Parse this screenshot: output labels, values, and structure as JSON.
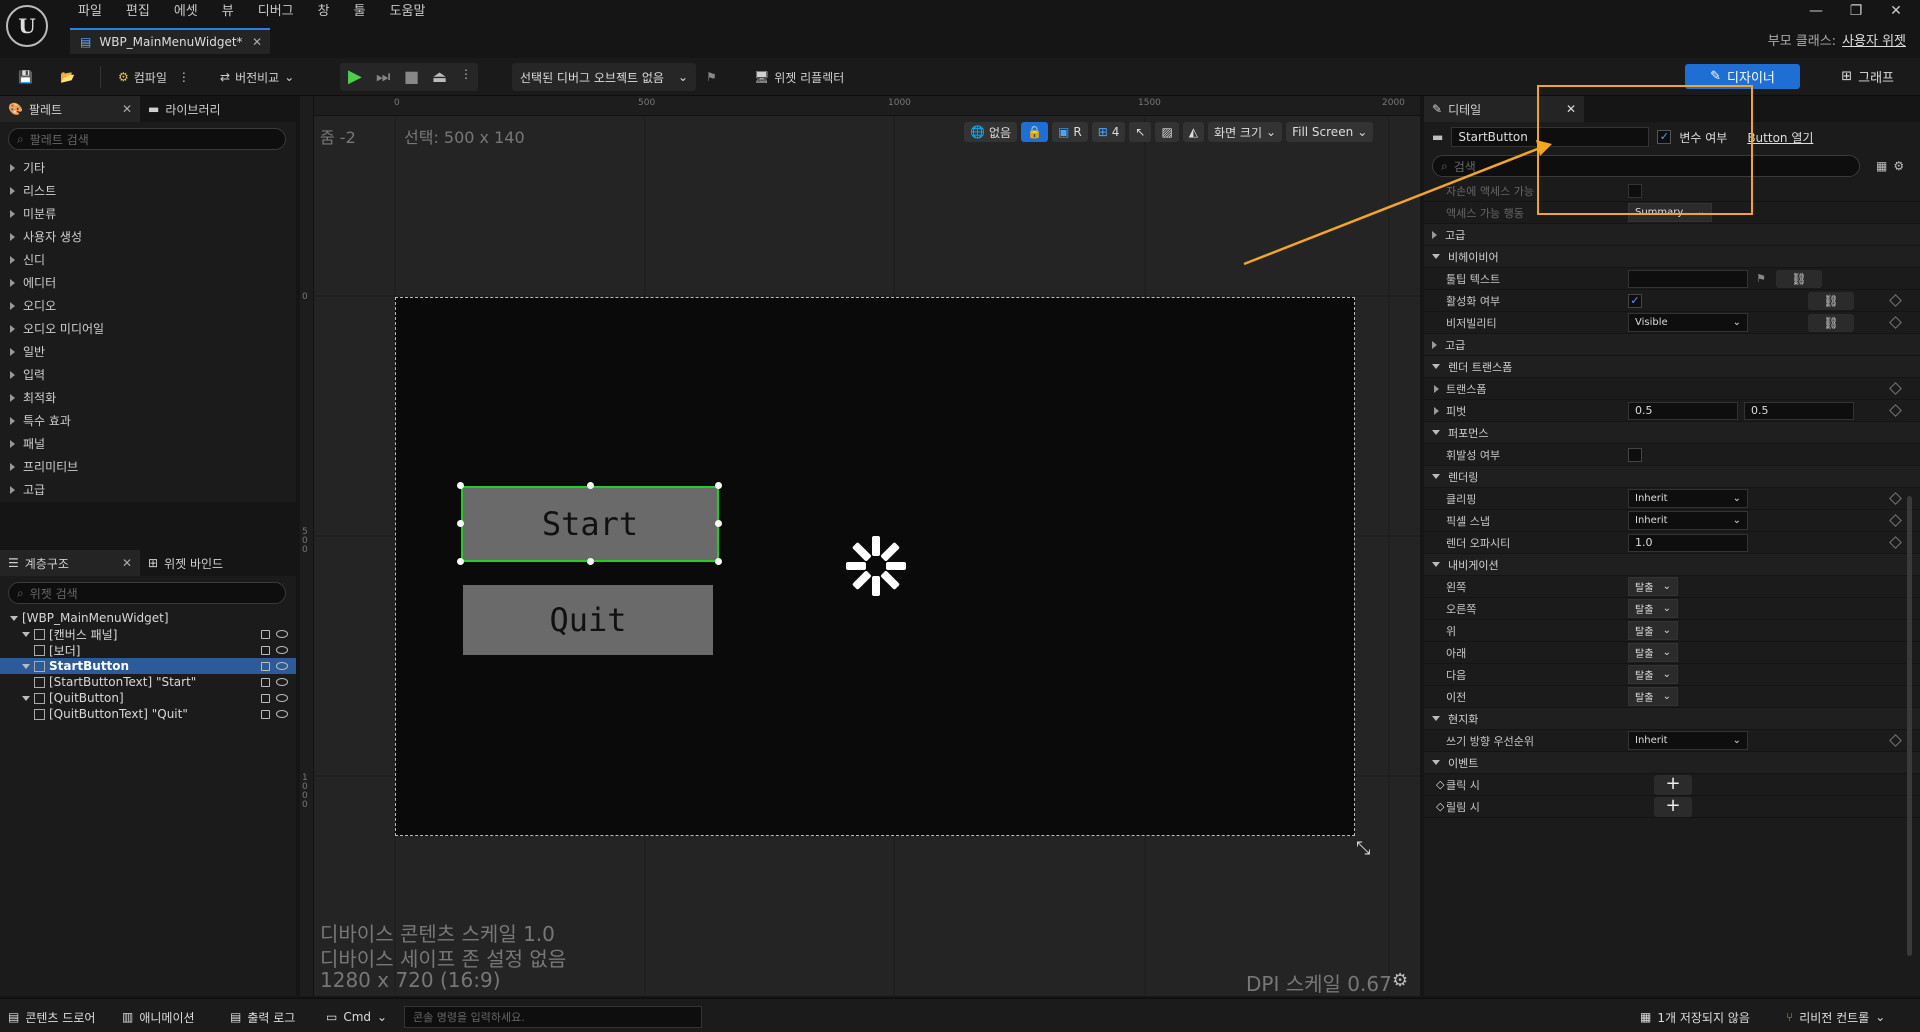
{
  "menu": [
    "파일",
    "편집",
    "에셋",
    "뷰",
    "디버그",
    "창",
    "툴",
    "도움말"
  ],
  "doc_tab": "WBP_MainMenuWidget*",
  "parent_class_label": "부모 클래스:",
  "parent_class_value": "사용자 위젯",
  "toolbar": {
    "compile": "컴파일",
    "diff": "버전비교",
    "debug_object": "선택된 디버그 오브젝트 없음",
    "widget_reflector": "위젯 리플렉터",
    "designer": "디자이너",
    "graph": "그래프"
  },
  "palette": {
    "tab": "팔레트",
    "library_tab": "라이브러리",
    "search_placeholder": "팔레트 검색",
    "categories": [
      "기타",
      "리스트",
      "미분류",
      "사용자 생성",
      "신디",
      "에디터",
      "오디오",
      "오디오 미디어일",
      "일반",
      "입력",
      "최적화",
      "특수 효과",
      "패널",
      "프리미티브",
      "고급"
    ]
  },
  "hierarchy": {
    "tab": "계층구조",
    "binding_tab": "위젯 바인드",
    "search_placeholder": "위젯 검색",
    "items": [
      {
        "label": "[WBP_MainMenuWidget]",
        "depth": 0
      },
      {
        "label": "[캔버스 패널]",
        "depth": 1
      },
      {
        "label": "[보더]",
        "depth": 2
      },
      {
        "label": "StartButton",
        "depth": 1
      },
      {
        "label": "[StartButtonText] \"Start\"",
        "depth": 2
      },
      {
        "label": "[QuitButton]",
        "depth": 1
      },
      {
        "label": "[QuitButtonText] \"Quit\"",
        "depth": 2
      }
    ]
  },
  "viewport": {
    "zoom": "줌 -2",
    "selection": "선택: 500 x 140",
    "ruler_labels": [
      "0",
      "500",
      "1000",
      "1500",
      "2000"
    ],
    "ruler_v_labels": [
      "0",
      "5 0 0",
      "1 0 0 0"
    ],
    "none_label": "없음",
    "r_label": "R",
    "grid_value": "4",
    "screen_size": "화면 크기",
    "fill_screen": "Fill Screen",
    "start_label": "Start",
    "quit_label": "Quit",
    "info1": "디바이스 콘텐츠 스케일 1.0",
    "info2": "디바이스 세이프 존 설정 없음",
    "info3": "1280 x 720 (16:9)",
    "dpi": "DPI 스케일 0.67"
  },
  "details": {
    "tab": "디테일",
    "name_value": "StartButton",
    "is_variable": "변수 여부",
    "open_button": "Button 열기",
    "search_placeholder": "검색",
    "rows": {
      "child_access": "자손에 액세스 가능",
      "access_action": "액세스 가능 행동",
      "summary": "Summary",
      "advanced1": "고급",
      "behavior": "비헤이비어",
      "tooltip": "툴팁 텍스트",
      "enabled": "활성화 여부",
      "visibility": "비저빌리티",
      "visible": "Visible",
      "advanced2": "고급",
      "render_transform": "렌더 트랜스폼",
      "transform": "트랜스폼",
      "pivot": "피벗",
      "pivot_x": "0.5",
      "pivot_y": "0.5",
      "performance": "퍼포먼스",
      "volatile": "휘발성 여부",
      "rendering": "렌더링",
      "clipping": "클리핑",
      "inherit": "Inherit",
      "pixel_snap": "픽셀 스냅",
      "render_opacity": "렌더 오파시티",
      "opacity_value": "1.0",
      "navigation": "내비게이션",
      "left": "왼쪽",
      "right": "오른쪽",
      "up": "위",
      "down": "아래",
      "next": "다음",
      "prev": "이전",
      "escape": "탈출",
      "localization": "현지화",
      "flow_direction": "쓰기 방향 우선순위",
      "events": "이벤트",
      "on_click": "클릭 시",
      "on_release": "릴림 시"
    }
  },
  "statusbar": {
    "content_drawer": "콘텐츠 드로어",
    "animation": "애니메이션",
    "output_log": "출력 로그",
    "cmd": "Cmd",
    "cmd_placeholder": "콘솔 명령을 입력하세요.",
    "unsaved": "1개 저장되지 않음",
    "revision": "리비전 컨트롤"
  },
  "colors": {
    "accent": "#1f6ed4",
    "annotation": "#f2a623",
    "selection_outline": "#22cc22",
    "selected_row": "#2d5b9a"
  }
}
